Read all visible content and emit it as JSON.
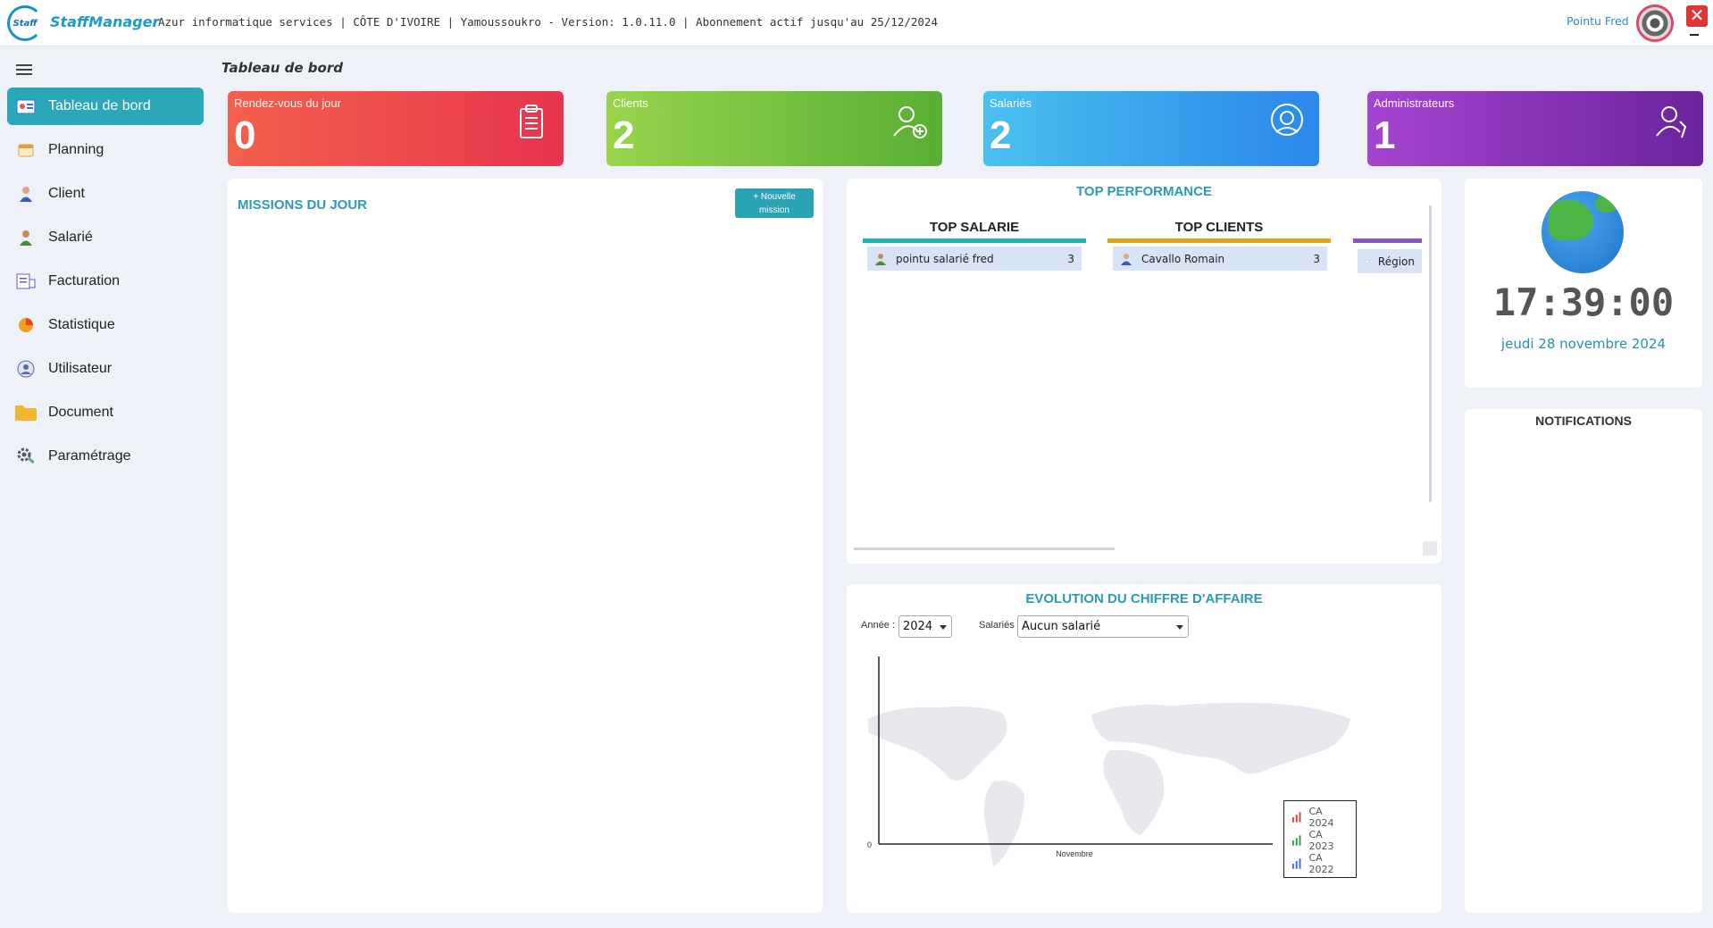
{
  "header": {
    "logo_text": "Staff",
    "brand": "StaffManager",
    "subtitle": "Azur informatique services | CÔTE D'IVOIRE | Yamoussoukro - Version: 1.0.11.0 |  Abonnement actif jusqu'au 25/12/2024",
    "user_name": "Pointu Fred",
    "close_label": "✕"
  },
  "sidebar": {
    "items": [
      {
        "label": "Tableau de bord",
        "icon": "dashboard-icon"
      },
      {
        "label": "Planning",
        "icon": "calendar-icon"
      },
      {
        "label": "Client",
        "icon": "client-icon"
      },
      {
        "label": "Salarié",
        "icon": "employee-icon"
      },
      {
        "label": "Facturation",
        "icon": "invoice-icon"
      },
      {
        "label": "Statistique",
        "icon": "pie-chart-icon"
      },
      {
        "label": "Utilisateur",
        "icon": "user-icon"
      },
      {
        "label": "Document",
        "icon": "folder-icon"
      },
      {
        "label": "Paramétrage",
        "icon": "settings-icon"
      }
    ]
  },
  "page": {
    "title": "Tableau de bord"
  },
  "cards": [
    {
      "label": "Rendez-vous du jour",
      "value": "0",
      "icon": "clipboard-icon"
    },
    {
      "label": "Clients",
      "value": "2",
      "icon": "add-client-icon"
    },
    {
      "label": "Salariés",
      "value": "2",
      "icon": "headset-icon"
    },
    {
      "label": "Administrateurs",
      "value": "1",
      "icon": "admin-icon"
    }
  ],
  "missions": {
    "title": "MISSIONS DU JOUR",
    "new_button_line1": "+ Nouvelle",
    "new_button_line2": "mission"
  },
  "top_performance": {
    "title": "TOP PERFORMANCE",
    "columns": [
      {
        "title": "TOP SALARIE",
        "color": "#1fb7b5",
        "row_name": "pointu salarié fred",
        "row_value": "3"
      },
      {
        "title": "TOP CLIENTS",
        "color": "#e6a21a",
        "row_name": "Cavallo Romain",
        "row_value": "3"
      },
      {
        "title": "",
        "color": "#8a55c4",
        "row_name": "Région",
        "row_value": ""
      }
    ]
  },
  "evolution": {
    "title": "EVOLUTION DU CHIFFRE D'AFFAIRE",
    "year_label": "Année :",
    "year_value": "2024",
    "employee_label": "Salariés",
    "employee_value": "Aucun salarié"
  },
  "chart_data": {
    "type": "bar",
    "categories": [
      "Novembre"
    ],
    "series": [
      {
        "name": "CA 2024",
        "values": [
          0
        ],
        "color": "#d9443a"
      },
      {
        "name": "CA 2023",
        "values": [
          0
        ],
        "color": "#2e9a4a"
      },
      {
        "name": "CA 2022",
        "values": [
          0
        ],
        "color": "#3b6fd6"
      }
    ],
    "y_tick": "0",
    "legend_position": "right"
  },
  "clock": {
    "time": "17:39:00",
    "date": "jeudi 28 novembre 2024"
  },
  "notifications": {
    "title": "NOTIFICATIONS"
  }
}
